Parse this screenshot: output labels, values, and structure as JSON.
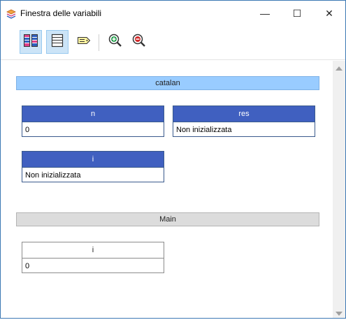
{
  "window": {
    "title": "Finestra delle variabili",
    "minimize_glyph": "—",
    "maximize_glyph": "☐",
    "close_glyph": "✕"
  },
  "toolbar": {
    "buttons": [
      {
        "icon": "split-view-icon",
        "active": true
      },
      {
        "icon": "list-view-icon",
        "active": true
      },
      {
        "icon": "tag-icon",
        "active": false
      },
      {
        "icon": "zoom-in-icon",
        "active": false
      },
      {
        "icon": "zoom-out-icon",
        "active": false
      }
    ]
  },
  "frames": [
    {
      "name": "catalan",
      "current": true,
      "variables": [
        {
          "name": "n",
          "value": "0"
        },
        {
          "name": "res",
          "value": "Non inizializzata"
        },
        {
          "name": "i",
          "value": "Non inizializzata"
        }
      ]
    },
    {
      "name": "Main",
      "current": false,
      "variables": [
        {
          "name": "i",
          "value": "0"
        }
      ]
    }
  ],
  "colors": {
    "current_frame_header": "#99ccff",
    "other_frame_header": "#dcdcdc",
    "variable_header": "#4060c0",
    "toolbar_active": "#cce4f7"
  }
}
